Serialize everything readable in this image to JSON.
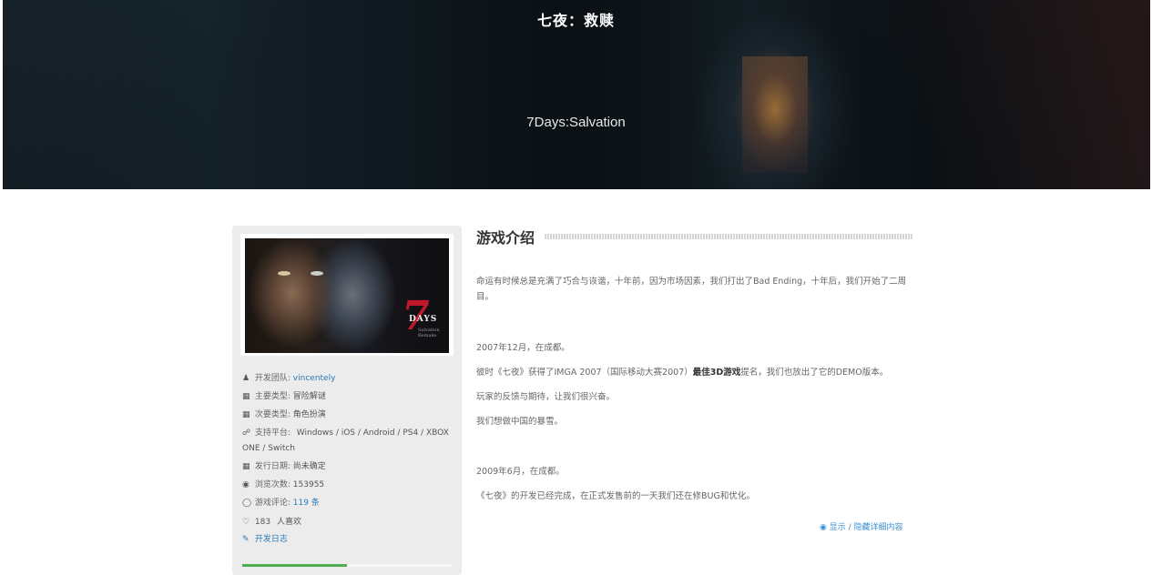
{
  "hero": {
    "title": "七夜：救赎",
    "subtitle": "7Days:Salvation"
  },
  "cover": {
    "logo_mark": "7",
    "logo_text": "DAYS",
    "logo_sub": "Salvation Remake"
  },
  "info": {
    "team": {
      "icon": "team-icon",
      "label": "开发团队:",
      "value": "vincentely"
    },
    "main_type": {
      "icon": "grid-icon",
      "label": "主要类型:",
      "value": "冒险解谜"
    },
    "sub_type": {
      "icon": "grid-icon",
      "label": "次要类型:",
      "value": "角色扮演"
    },
    "platform": {
      "icon": "platform-icon",
      "label": "支持平台:",
      "value_line1": "Windows / iOS / Android / PS4 / XBOX",
      "value_line2": "ONE / Switch"
    },
    "release": {
      "icon": "calendar-icon",
      "label": "发行日期:",
      "value": "尚未确定"
    },
    "views": {
      "icon": "eye-icon",
      "label": "浏览次数:",
      "value": "153955"
    },
    "comments": {
      "icon": "comment-icon",
      "label": "游戏评论:",
      "value": "119 条"
    },
    "likes": {
      "icon": "heart-icon",
      "count": "183",
      "suffix": "人喜欢"
    },
    "devlog": {
      "icon": "edit-icon",
      "label": "开发日志"
    },
    "progress": 0.5
  },
  "intro": {
    "title": "游戏介绍",
    "p1": "命运有时候总是充满了巧合与诙谐，十年前，因为市场因素，我们打出了Bad Ending，十年后，我们开始了二周目。",
    "p2": "2007年12月，在成都。",
    "p3_before": "彼时《七夜》获得了IMGA 2007（国际移动大赛2007）",
    "p3_bold": "最佳3D游戏",
    "p3_after": "提名，我们也放出了它的DEMO版本。",
    "p4": "玩家的反馈与期待，让我们很兴奋。",
    "p5": "我们想做中国的暴雪。",
    "p6": "2009年6月，在成都。",
    "p7": "《七夜》的开发已经完成，在正式发售前的一天我们还在修BUG和优化。",
    "toggle_label": "显示 / 隐藏详细内容"
  }
}
